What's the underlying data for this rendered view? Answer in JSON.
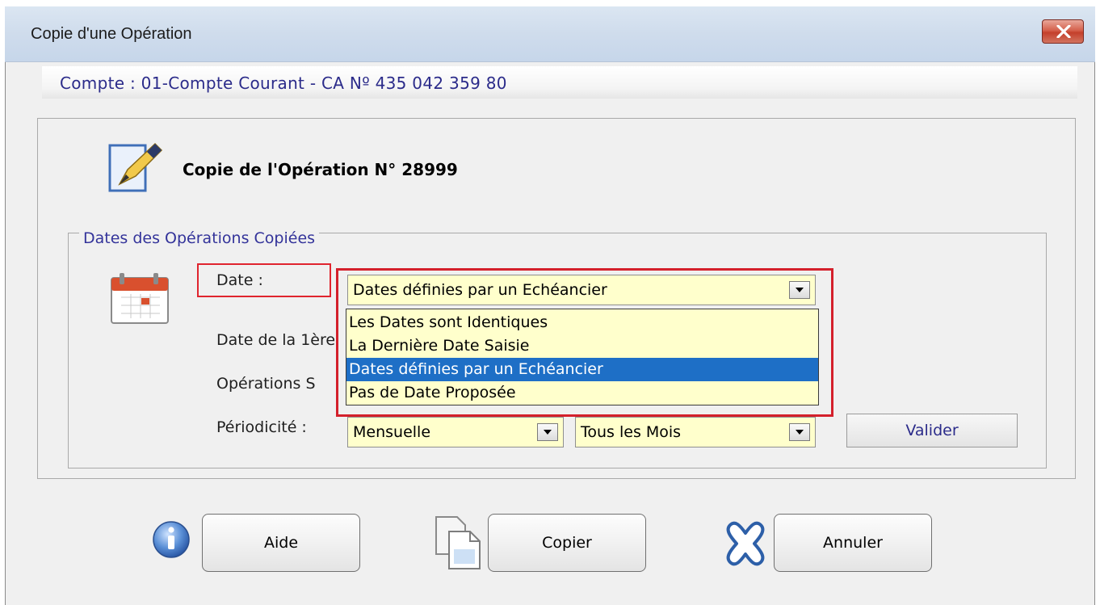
{
  "window": {
    "title": "Copie d'une Opération"
  },
  "account": {
    "text": "Compte : 01-Compte Courant - CA Nº 435 042 359 80"
  },
  "header": {
    "heading": "Copie de l'Opération N° 28999"
  },
  "group": {
    "legend": "Dates des Opérations Copiées",
    "date_label": "Date :",
    "first_date_label": "Date de la 1ère",
    "operations_label": "Opérations S",
    "periodicity_label": "Périodicité :"
  },
  "date_combo": {
    "value": "Dates définies par un Echéancier",
    "options": [
      "Les Dates sont Identiques",
      "La Dernière Date Saisie",
      "Dates définies par un Echéancier",
      "Pas de Date Proposée"
    ],
    "selected_index": 2
  },
  "periodicity": {
    "frequency": "Mensuelle",
    "interval": "Tous les Mois"
  },
  "buttons": {
    "validate": "Valider",
    "help": "Aide",
    "copy": "Copier",
    "cancel": "Annuler"
  },
  "colors": {
    "highlight_red": "#d4202b",
    "selection_blue": "#1e6fc6",
    "combo_bg": "#ffffcc",
    "label_blue": "#33339a"
  }
}
